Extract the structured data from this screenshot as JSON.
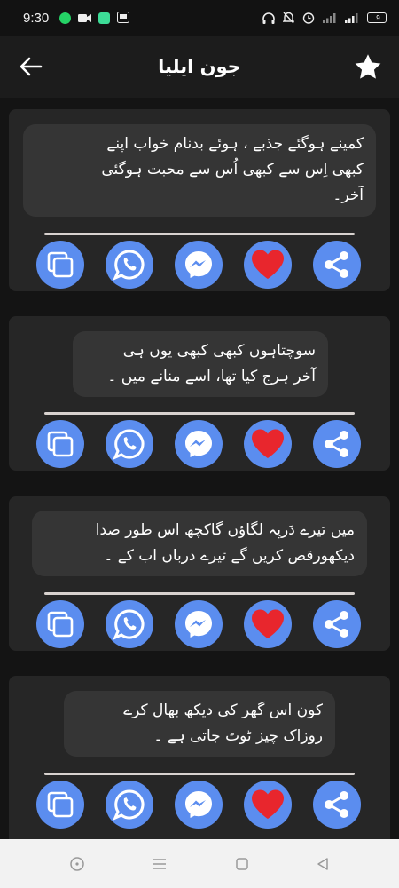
{
  "status_bar": {
    "time": "9:30",
    "battery": "9",
    "left_icons": [
      "whatsapp-icon",
      "video-icon",
      "chat-icon",
      "cast-icon"
    ],
    "right_icons": [
      "headphones-icon",
      "mute-icon",
      "alarm-icon",
      "signal-icon",
      "signal-icon",
      "battery-icon"
    ]
  },
  "header": {
    "title": "جون ایلیا",
    "back_icon": "arrow-left-icon",
    "favorite_icon": "star-icon"
  },
  "poems": [
    {
      "lines": [
        "کمینے ہوگئے جذبے ، ہوئے بدنام خواب اپنے",
        "کبھی اِس سے کبھی اُس سے محبت ہوگئی",
        "آخر۔"
      ]
    },
    {
      "lines": [
        "سوچتاہوں کبھی کبھی یوں ہی",
        "آخر ہرج کیا تھا، اسے منانے میں ۔"
      ]
    },
    {
      "lines": [
        "میں تیرے دَرپہ لگاؤں گاکچھ اس طور صدا",
        "دیکھورقص کریں گے تیرے درباں اب کے ۔"
      ]
    },
    {
      "lines": [
        "کون اس گھر کی دیکھ بھال کرے",
        "روزاک چیز ٹوٹ جاتی ہے ۔"
      ]
    }
  ],
  "actions": [
    "copy-icon",
    "whatsapp-icon",
    "messenger-icon",
    "heart-icon",
    "share-icon"
  ],
  "colors": {
    "background": "#141414",
    "card": "#262626",
    "bubble": "#353535",
    "action_blue": "#5b8def",
    "heart_red": "#e8262d"
  },
  "nav_bar": [
    "home-circle-icon",
    "menu-icon",
    "recents-square-icon",
    "back-triangle-icon"
  ]
}
